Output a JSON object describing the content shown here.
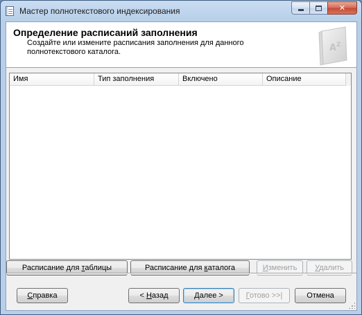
{
  "window": {
    "title": "Мастер полнотекстового индексирования"
  },
  "header": {
    "title": "Определение расписаний заполнения",
    "description": "Создайте или измените расписания заполнения для данного полнотекстового каталога."
  },
  "grid": {
    "columns": [
      "Имя",
      "Тип заполнения",
      "Включено",
      "Описание"
    ],
    "rows": []
  },
  "actions": {
    "table_schedule_prefix": "Расписание для ",
    "table_schedule_accel": "т",
    "table_schedule_suffix": "аблицы",
    "catalog_schedule_prefix": "Расписание для ",
    "catalog_schedule_accel": "к",
    "catalog_schedule_suffix": "аталога",
    "edit_accel": "И",
    "edit_suffix": "зменить",
    "delete_accel": "У",
    "delete_suffix": "далить"
  },
  "footer": {
    "help_accel": "С",
    "help_suffix": "правка",
    "back_prefix": "< ",
    "back_accel": "Н",
    "back_suffix": "азад",
    "next_accel": "Д",
    "next_suffix": "алее >",
    "finish_accel": "Г",
    "finish_suffix": "отово >>|",
    "cancel_label": "Отмена"
  },
  "icons": {
    "window_icon": "form-icon",
    "header_icon": "book-az-icon"
  }
}
